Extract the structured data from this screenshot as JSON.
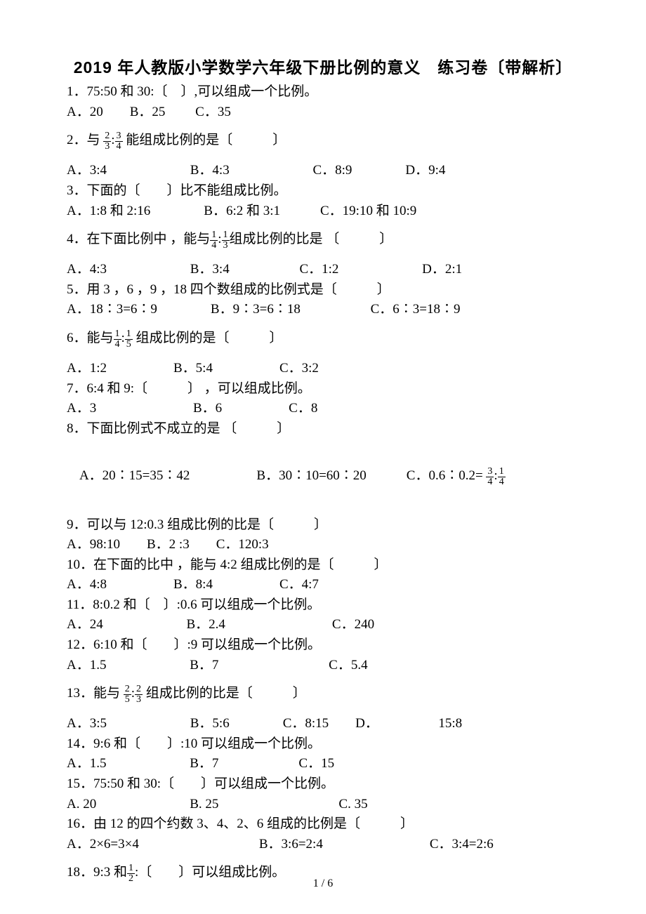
{
  "title": "2019 年人教版小学数学六年级下册比例的意义　练习卷〔带解析〕",
  "q1_text": "1．75:50 和 30:〔　〕,可以组成一个比例。",
  "q1_opts": "A．20　　B．25　　 C．35",
  "q2_pre": "2．与 ",
  "q2_post": " 能组成比例的是〔　　　〕",
  "q2_opts": "A．3:4　　　　　　 B．4:3　　　　　　 C．8:9　　　　D．9:4",
  "q3_text": "3．下面的〔　　〕比不能组成比例。",
  "q3_opts": "A．1:8 和 2:16　　　　B．6:2 和 3:1　　　C．19:10 和 10:9",
  "q4_pre": "4．在下面比例中 ，能与",
  "q4_post": "组成比例的比是 〔　　　〕",
  "q4_opts": "A．4:3　　　　　　 B．3:4　　　　　 C．1:2　　　　　　 D．2:1",
  "q5_text": "5．用 3 ，6 ，9 ，18 四个数组成的比例式是〔　　　〕",
  "q5_opts": "A．18∶3=6∶9　　　　B．9∶3=6∶18　　　　　 C．6∶3=18∶9",
  "q6_pre": "6．能与",
  "q6_post": " 组成比例的是〔　　　〕",
  "q6_opts": "A．1:2　　　　　B．5:4　　　　　C．3:2",
  "q7_text": "7．6:4 和 9:〔　　　〕 ，可以组成比例。",
  "q7_opts": "A．3　　　　　　　 B．6　　　　　C．8",
  "q8_text": "8．下面比例式不成立的是 〔　　　〕",
  "q8_opts_pre": "A．20∶15=35∶42　　　　　B．30∶10=60∶20　　　C．0.6∶0.2= ",
  "q9_text": "9．可以与 12:0.3 组成比例的比是〔　　　〕",
  "q9_opts": "A．98:10　　B．2 :3　　C．120:3",
  "q10_text": "10．在下面的比中 ，能与 4:2 组成比例的是〔　　　〕",
  "q10_opts": "A．4:8　　　　　B．8:4　　　　　C．4:7",
  "q11_text": "11．8:0.2 和〔　〕:0.6 可以组成一个比例。",
  "q11_opts": "A．24　　　　　　 B．2.4　　　　　　　　C．240",
  "q12_text": "12．6:10 和〔　　〕:9 可以组成一个比例。",
  "q12_opts": "A．1.5　　　　　　 B．7　　　　　　　　 C．5.4",
  "q13_pre": "13．能与 ",
  "q13_post": " 组成比例的比是〔　　　〕",
  "q13_opts": "A．3:5　　　　　　 B．5:6　　　　C．8:15　　D．　　　　　15:8",
  "q14_text": "14．9:6 和〔　　〕:10 可以组成一个比例。",
  "q14_opts": "A．1.5　　　　　　 B．7　　　　　　C．15",
  "q15_text": "15．75:50 和 30:〔　　〕可以组成一个比例。",
  "q15_opts": "A. 20　　　　　　　B. 25　　　　　　　　　C. 35",
  "q16_text": "16．由 12 的四个约数 3、4、2、6 组成的比例是〔　　　〕",
  "q16_opts": "A．2×6=3×4　　　　　　　　　B．3:6=2:4　　　　　　　　C．3:4=2:6",
  "q18_pre": "18．9:3 和",
  "q18_post": ":〔　　〕可以组成比例。",
  "pageno": "1 / 6",
  "f_2_3": {
    "n": "2",
    "d": "3"
  },
  "f_3_4": {
    "n": "3",
    "d": "4"
  },
  "f_1_4": {
    "n": "1",
    "d": "4"
  },
  "f_1_3": {
    "n": "1",
    "d": "3"
  },
  "f_1_5": {
    "n": "1",
    "d": "5"
  },
  "f_2_5": {
    "n": "2",
    "d": "5"
  },
  "f_2_3b": {
    "n": "2",
    "d": "3"
  },
  "f_1_2": {
    "n": "1",
    "d": "2"
  },
  "f_3_4b": {
    "n": "3",
    "d": "4"
  },
  "f_1_4b": {
    "n": "1",
    "d": "4"
  },
  "colon": ":"
}
